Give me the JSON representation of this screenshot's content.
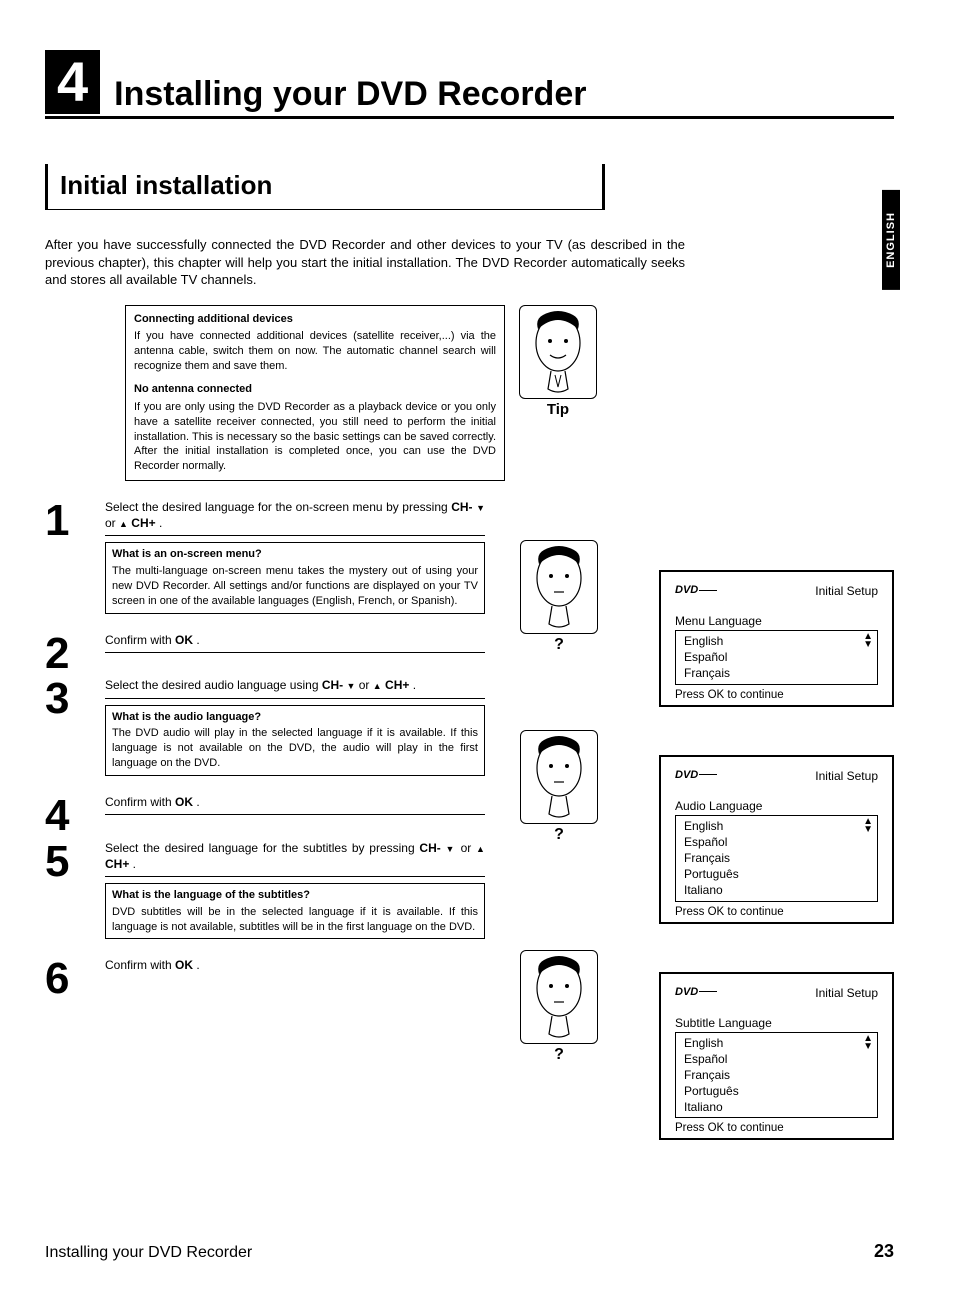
{
  "chapter": {
    "num": "4",
    "title": "Installing your DVD Recorder"
  },
  "section": {
    "title": "Initial installation"
  },
  "lang_tab": "ENGLISH",
  "intro": "After you have successfully connected the DVD Recorder and other devices to your TV (as described in the previous chapter), this chapter will help you start the initial installation. The DVD Recorder automatically seeks and stores all available TV channels.",
  "tip": {
    "h1": "Connecting additional devices",
    "p1": "If you have connected additional devices (satellite receiver,...) via the antenna cable, switch them on now. The automatic channel search will recognize them and save them.",
    "h2": "No antenna connected",
    "p2": "If you are only using the DVD Recorder as a playback device or you only have a satellite receiver connected, you still need to perform the initial installation. This is necessary so the basic settings can be saved correctly. After the initial installation is completed once, you can use the DVD Recorder normally.",
    "label": "Tip"
  },
  "steps": {
    "s1": {
      "num": "1",
      "text_a": "Select the desired language for the on-screen menu by pressing ",
      "chm": "CH-",
      "or": " or ",
      "chp": "CH+",
      "dot": " .",
      "callout_h": "What is an on-screen menu?",
      "callout_p": "The multi-language on-screen menu takes the mystery out of using your new DVD Recorder. All settings and/or functions are displayed on your TV screen in one of the available languages (English, French, or Spanish)."
    },
    "s2": {
      "num": "2",
      "text": "Confirm with ",
      "ok": "OK",
      "dot": " ."
    },
    "s3": {
      "num": "3",
      "text_a": "Select the desired audio language using ",
      "chm": "CH-",
      "or": " or ",
      "chp": "CH+",
      "dot": " .",
      "callout_h": "What is the audio language?",
      "callout_p": "The DVD audio will play in the selected language if it is available. If this language is not available on the DVD, the audio will play in the first language on the DVD."
    },
    "s4": {
      "num": "4",
      "text": "Confirm with ",
      "ok": "OK",
      "dot": " ."
    },
    "s5": {
      "num": "5",
      "text_a": "Select the desired language for the subtitles by pressing ",
      "chm": "CH-",
      "or": " or ",
      "chp": "CH+",
      "dot": " .",
      "callout_h": "What is the language of the subtitles?",
      "callout_p": "DVD subtitles will be in the selected language if it is available. If this language is not available, subtitles will be in the first language on the DVD."
    },
    "s6": {
      "num": "6",
      "text": "Confirm with ",
      "ok": "OK",
      "dot": " ."
    }
  },
  "screens": {
    "s1": {
      "logo": "DVD",
      "title": "Initial Setup",
      "label": "Menu Language",
      "opts": [
        "English",
        "Español",
        "Français"
      ],
      "foot": "Press OK to continue"
    },
    "s2": {
      "logo": "DVD",
      "title": "Initial Setup",
      "label": "Audio Language",
      "opts": [
        "English",
        "Español",
        "Français",
        "Português",
        "Italiano"
      ],
      "foot": "Press OK to continue"
    },
    "s3": {
      "logo": "DVD",
      "title": "Initial Setup",
      "label": "Subtitle Language",
      "opts": [
        "English",
        "Español",
        "Français",
        "Português",
        "Italiano"
      ],
      "foot": "Press OK to continue"
    }
  },
  "q": "?",
  "footer": {
    "left": "Installing your DVD Recorder",
    "right": "23"
  }
}
